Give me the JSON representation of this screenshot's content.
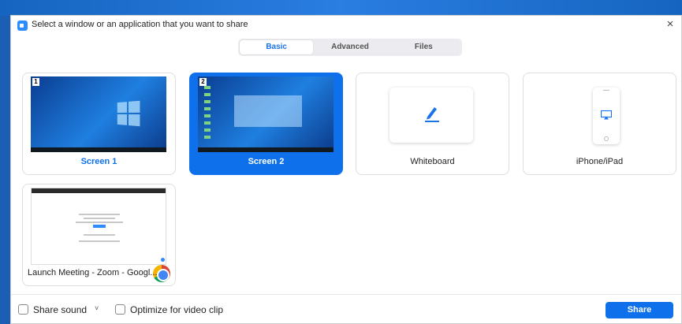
{
  "window": {
    "title": "Select a window or an application that you want to share",
    "close_glyph": "×"
  },
  "tabs": [
    {
      "label": "Basic",
      "active": true
    },
    {
      "label": "Advanced",
      "active": false
    },
    {
      "label": "Files",
      "active": false
    }
  ],
  "tiles": [
    {
      "label": "Screen 1",
      "badge": "1"
    },
    {
      "label": "Screen 2",
      "badge": "2",
      "selected": true
    },
    {
      "label": "Whiteboard"
    },
    {
      "label": "iPhone/iPad"
    },
    {
      "label": "Launch Meeting - Zoom - Googl..."
    }
  ],
  "footer": {
    "share_sound": "Share sound",
    "chevron": "˅",
    "optimize_video": "Optimize for video clip",
    "share_button": "Share"
  },
  "colors": {
    "accent": "#0e71eb",
    "selected_tile": "#0e71eb"
  }
}
